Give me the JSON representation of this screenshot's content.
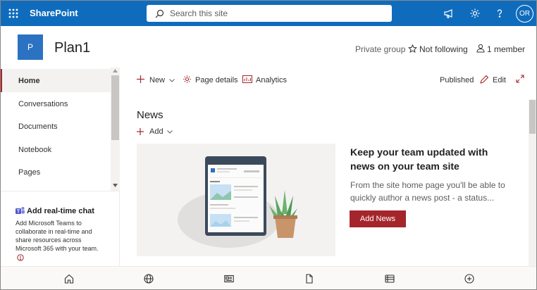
{
  "topbar": {
    "brand": "SharePoint",
    "search_placeholder": "Search this site",
    "avatar_initials": "OR",
    "color": "#0f6cbd"
  },
  "site": {
    "logo_letter": "P",
    "title": "Plan1",
    "privacy": "Private group",
    "follow": "Not following",
    "members": "1 member"
  },
  "nav": {
    "items": [
      {
        "label": "Home"
      },
      {
        "label": "Conversations"
      },
      {
        "label": "Documents"
      },
      {
        "label": "Notebook"
      },
      {
        "label": "Pages"
      }
    ],
    "chat_title": "Add real-time chat",
    "chat_desc": "Add Microsoft Teams to collaborate in real-time and share resources across Microsoft 365 with your team."
  },
  "commandbar": {
    "new_label": "New",
    "page_details_label": "Page details",
    "analytics_label": "Analytics",
    "status": "Published",
    "edit_label": "Edit"
  },
  "news": {
    "heading": "News",
    "add_label": "Add",
    "hero_title": "Keep your team updated with news on your team site",
    "hero_desc": "From the site home page you'll be able to quickly author a news post - a status...",
    "add_news_label": "Add News"
  },
  "colors": {
    "accent": "#a4262c",
    "brand_blue": "#0f6cbd"
  }
}
